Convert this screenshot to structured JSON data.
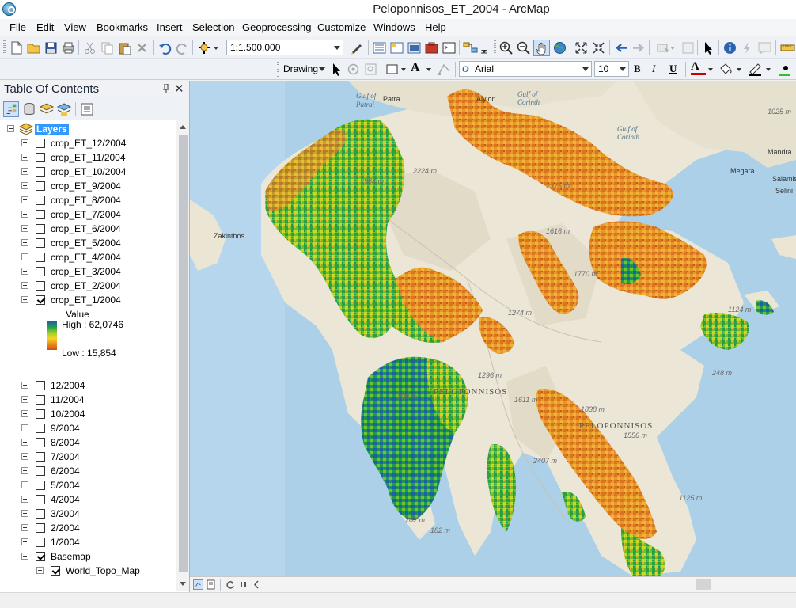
{
  "window": {
    "title": "Peloponnisos_ET_2004 - ArcMap"
  },
  "menu": [
    "File",
    "Edit",
    "View",
    "Bookmarks",
    "Insert",
    "Selection",
    "Geoprocessing",
    "Customize",
    "Windows",
    "Help"
  ],
  "toolbar": {
    "scale_value": "1:1.500.000",
    "drawing_label": "Drawing",
    "font_name": "Arial",
    "font_size": "10",
    "bold": "B",
    "italic": "I",
    "underline": "U",
    "font_color_letter": "A",
    "text_tool": "A"
  },
  "toc": {
    "title": "Table Of Contents",
    "pin": "4",
    "close": "✕",
    "root_label": "Layers",
    "crop_layers": [
      {
        "label": "crop_ET_12/2004",
        "checked": false
      },
      {
        "label": "crop_ET_11/2004",
        "checked": false
      },
      {
        "label": "crop_ET_10/2004",
        "checked": false
      },
      {
        "label": "crop_ET_9/2004",
        "checked": false
      },
      {
        "label": "crop_ET_8/2004",
        "checked": false
      },
      {
        "label": "crop_ET_7/2004",
        "checked": false
      },
      {
        "label": "crop_ET_6/2004",
        "checked": false
      },
      {
        "label": "crop_ET_5/2004",
        "checked": false
      },
      {
        "label": "crop_ET_4/2004",
        "checked": false
      },
      {
        "label": "crop_ET_3/2004",
        "checked": false
      },
      {
        "label": "crop_ET_2/2004",
        "checked": false
      },
      {
        "label": "crop_ET_1/2004",
        "checked": true
      }
    ],
    "legend": {
      "heading": "Value",
      "high": "High : 62,0746",
      "low": "Low : 15,854",
      "colors": [
        "#1f5fa8",
        "#22a04a",
        "#9ccf2a",
        "#f5d423",
        "#e98a1c",
        "#c2521a"
      ]
    },
    "month_layers": [
      {
        "label": "12/2004",
        "checked": false
      },
      {
        "label": "11/2004",
        "checked": false
      },
      {
        "label": "10/2004",
        "checked": false
      },
      {
        "label": "9/2004",
        "checked": false
      },
      {
        "label": "8/2004",
        "checked": false
      },
      {
        "label": "7/2004",
        "checked": false
      },
      {
        "label": "6/2004",
        "checked": false
      },
      {
        "label": "5/2004",
        "checked": false
      },
      {
        "label": "4/2004",
        "checked": false
      },
      {
        "label": "3/2004",
        "checked": false
      },
      {
        "label": "2/2004",
        "checked": false
      },
      {
        "label": "1/2004",
        "checked": false
      }
    ],
    "basemap_label": "Basemap",
    "basemap_child": "World_Topo_Map"
  },
  "map": {
    "labels": {
      "gulf_patrai": "Gulf of",
      "gulf_patrai2": "Patrai",
      "patra": "Patra",
      "aiyion": "Aiyion",
      "gulf_corinth_a": "Gulf of",
      "gulf_corinth_a2": "Corinth",
      "gulf_corinth_b": "Gulf of",
      "gulf_corinth_b2": "Corinth",
      "zakinthos": "Zakinthos",
      "megara": "Megara",
      "mandra": "Mandra",
      "salamis": "Salamis",
      "selini": "Selini",
      "peloponnisos_1": "PELOPONNISOS",
      "peloponnisos_2": "PELOPONNISOS",
      "e2224": "2224 m",
      "e964": "964 m",
      "e2375": "2375 m",
      "e1616": "1616 m",
      "e1770": "1770 m",
      "e1274": "1274 m",
      "e1296": "1296 m",
      "e1611": "1611 m",
      "e1838": "1838 m",
      "e1556": "1556 m",
      "e2407": "2407 m",
      "e1125": "1125 m",
      "e1124": "1124 m",
      "e248": "248 m",
      "e228": "228 m",
      "e202": "202 m",
      "e182": "182 m",
      "e1025": "1025 m"
    }
  }
}
